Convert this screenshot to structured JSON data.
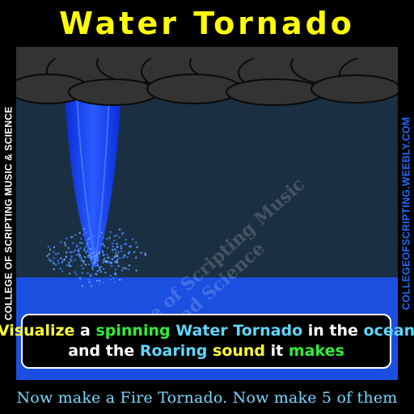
{
  "title": "Water Tornado",
  "side_text_left": "COLLEGE OF SCRIPTING MUSIC & SCIENCE",
  "side_text_right": "COLLEGEOFSCRIPTING.WEEBLY.COM",
  "watermark": {
    "line1": "College of Scripting Music",
    "line2": "and Science"
  },
  "caption": {
    "line1": [
      {
        "text": "Visualize",
        "color": "#ffff33"
      },
      {
        "text": " a ",
        "color": "#ffffff"
      },
      {
        "text": "spinning",
        "color": "#33ee33"
      },
      {
        "text": " Water Tornado",
        "color": "#5fd6ff"
      },
      {
        "text": " in the ",
        "color": "#ffffff"
      },
      {
        "text": "ocean",
        "color": "#5fd6ff"
      }
    ],
    "line2": [
      {
        "text": "and the ",
        "color": "#ffffff"
      },
      {
        "text": "Roaring",
        "color": "#5fd6ff"
      },
      {
        "text": " sound",
        "color": "#ffff33"
      },
      {
        "text": " it ",
        "color": "#ffffff"
      },
      {
        "text": "makes",
        "color": "#33ee33"
      }
    ]
  },
  "footer": "Now make a Fire Tornado. Now make 5 of them",
  "colors": {
    "title": "#ffff00",
    "sky": "#1a3042",
    "ocean": "#1a4fe0",
    "cloud": "#333333",
    "tornado": "#1f45ff"
  }
}
